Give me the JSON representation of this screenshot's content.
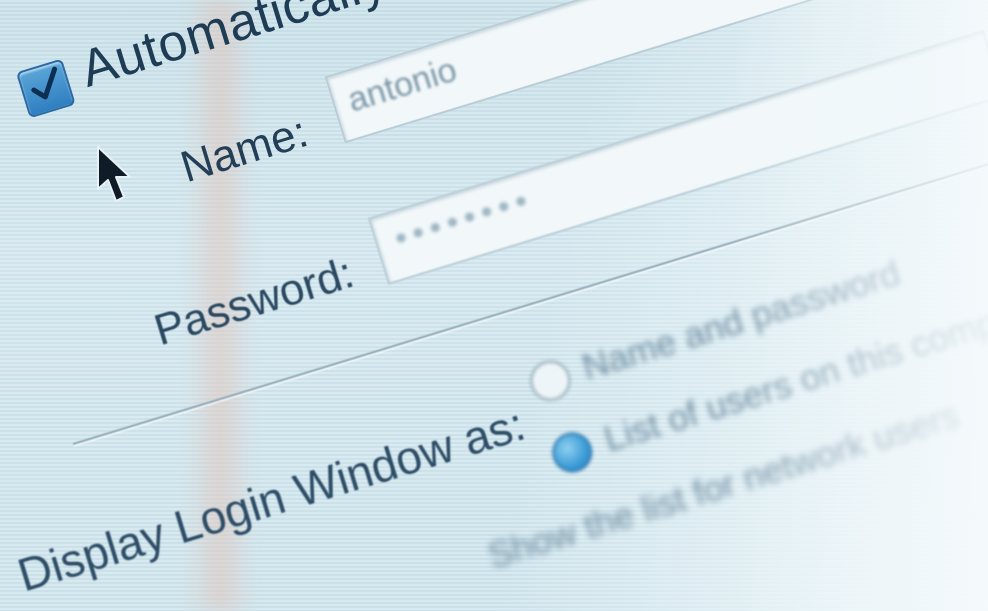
{
  "login_settings": {
    "auto_login_label": "Automatically log",
    "auto_login_checked": true,
    "name_label": "Name:",
    "name_value": "antonio",
    "password_label": "Password:",
    "password_mask": "••••••••",
    "display_label": "Display Login Window as:",
    "radio_options": [
      {
        "label": "Name and password",
        "selected": false
      },
      {
        "label": "List of users on this computer",
        "selected": true
      },
      {
        "label": "Show the list for network users",
        "selected": false
      }
    ]
  },
  "colors": {
    "background": "#cfe3ea",
    "checkbox_accent": "#2f7ec0",
    "label_text": "#1f3c55",
    "radio_selected": "#3a9ad6"
  },
  "icons": {
    "cursor": "arrow-pointer-icon",
    "checkmark": "checkmark-icon"
  }
}
